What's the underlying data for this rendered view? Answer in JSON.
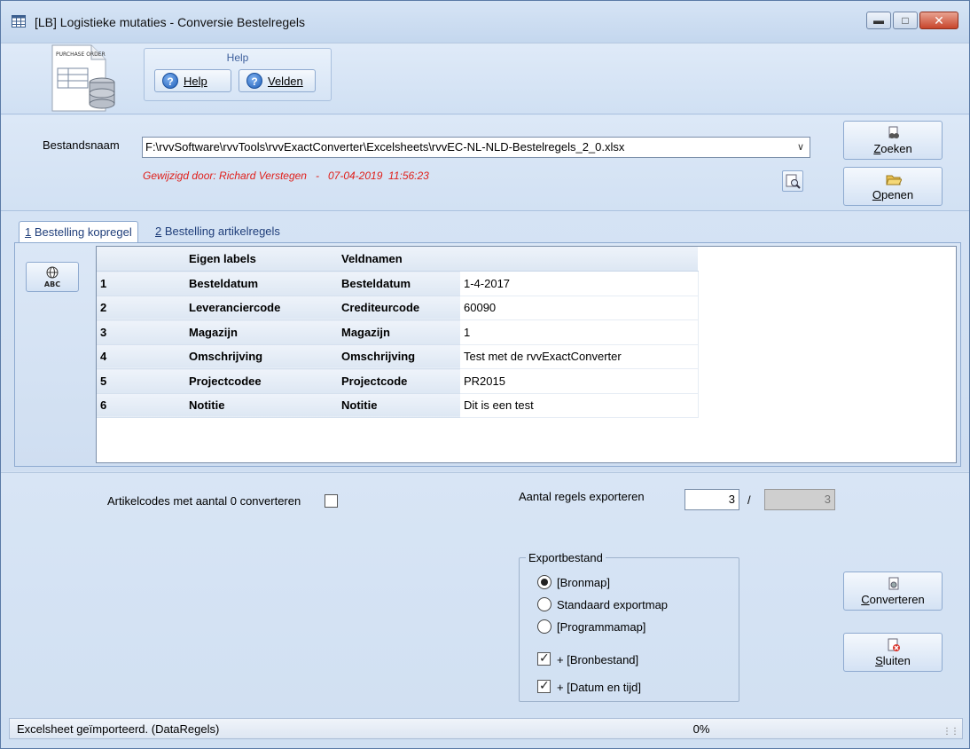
{
  "window": {
    "title": "[LB]  Logistieke mutaties - Conversie Bestelregels"
  },
  "ribbon": {
    "group_title": "Help",
    "doc_icon_text": "PURCHASE ORDER",
    "help_label": "Help",
    "velden_label": "Velden"
  },
  "file": {
    "label": "Bestandsnaam",
    "path": "F:\\rvvSoftware\\rvvTools\\rvvExactConverter\\Excelsheets\\rvvEC-NL-NLD-Bestelregels_2_0.xlsx",
    "modified": "Gewijzigd door: Richard Verstegen   -   07-04-2019  11:56:23",
    "zoeken_label": "Zoeken",
    "openen_label": "Openen"
  },
  "tabs": [
    {
      "key": "1",
      "label": "Bestelling kopregel"
    },
    {
      "key": "2",
      "label": "Bestelling artikelregels"
    }
  ],
  "grid": {
    "headers": [
      "",
      "Eigen labels",
      "Veldnamen",
      ""
    ],
    "rows": [
      {
        "nr": "1",
        "label": "Besteldatum",
        "field": "Besteldatum",
        "value": "1-4-2017"
      },
      {
        "nr": "2",
        "label": "Leveranciercode",
        "field": "Crediteurcode",
        "value": "60090"
      },
      {
        "nr": "3",
        "label": "Magazijn",
        "field": "Magazijn",
        "value": "1"
      },
      {
        "nr": "4",
        "label": "Omschrijving",
        "field": "Omschrijving",
        "value": "Test met de rvvExactConverter"
      },
      {
        "nr": "5",
        "label": "Projectcodee",
        "field": "Projectcode",
        "value": "PR2015"
      },
      {
        "nr": "6",
        "label": "Notitie",
        "field": "Notitie",
        "value": "Dit is een test"
      }
    ],
    "abc_text": "ABC"
  },
  "options": {
    "artikel_label": "Artikelcodes met aantal 0 converteren",
    "artikel_checked": false,
    "aantal_label": "Aantal regels exporteren",
    "aantal_value": "3",
    "separator": "/",
    "aantal_total": "3"
  },
  "export": {
    "legend": "Exportbestand",
    "radios": [
      {
        "label": "[Bronmap]",
        "selected": true
      },
      {
        "label": "Standaard exportmap",
        "selected": false
      },
      {
        "label": "[Programmamap]",
        "selected": false
      }
    ],
    "checks": [
      {
        "label": "+ [Bronbestand]",
        "checked": true
      },
      {
        "label": "+ [Datum en tijd]",
        "checked": true
      }
    ]
  },
  "actions": {
    "converteren_label": "Converteren",
    "sluiten_label": "Sluiten"
  },
  "status": {
    "text": "Excelsheet geïmporteerd. (DataRegels)",
    "progress": "0%"
  }
}
